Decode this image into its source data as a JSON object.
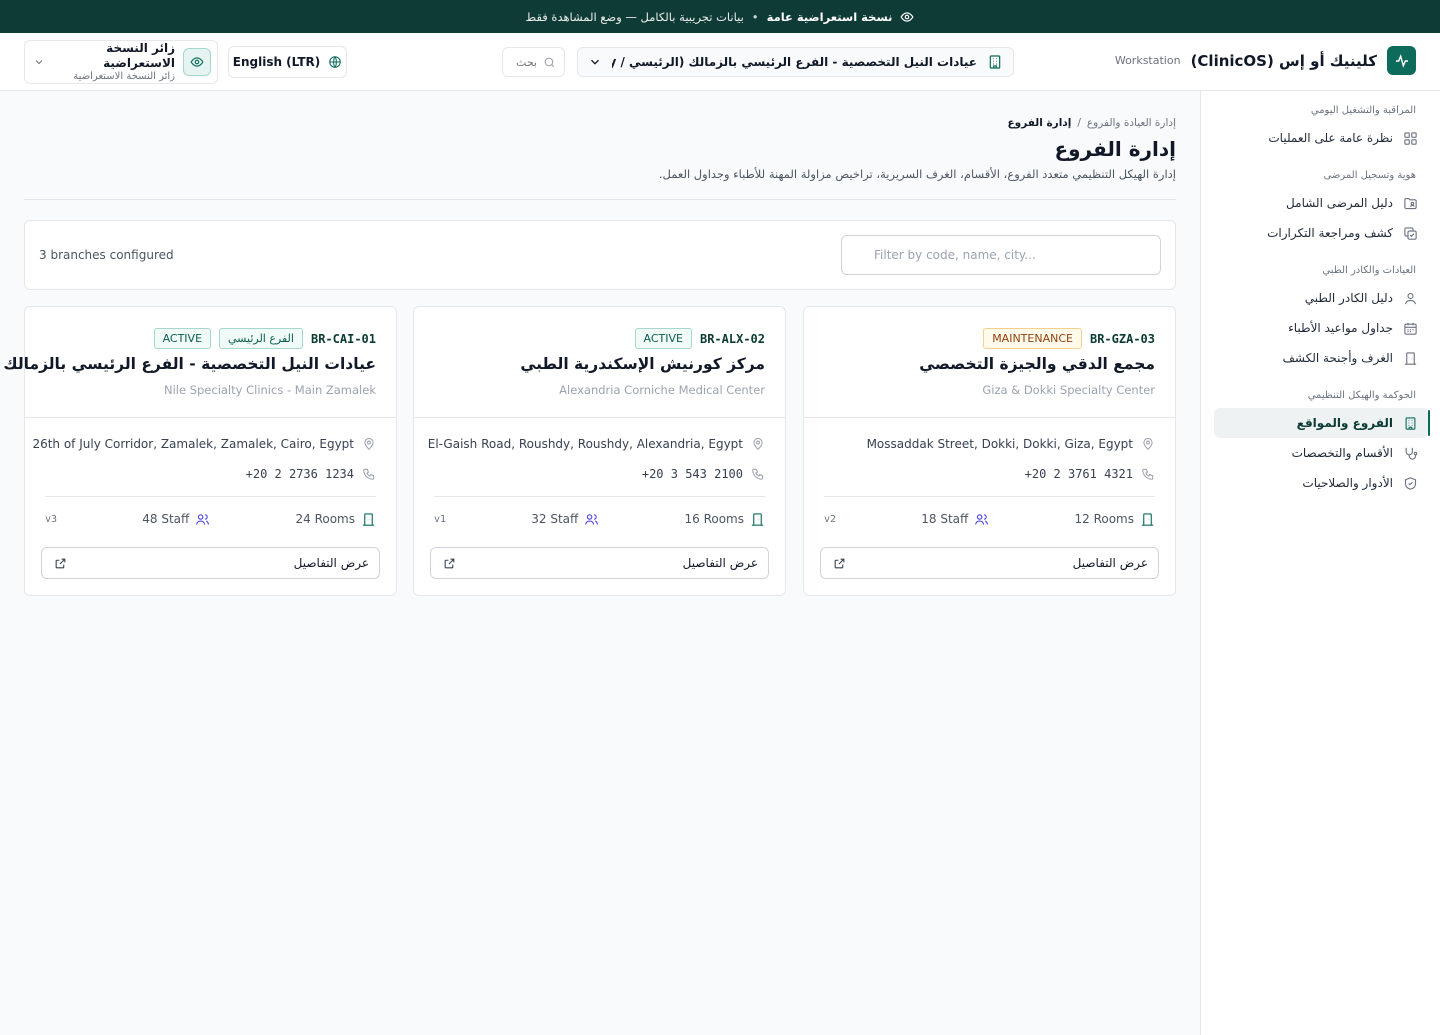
{
  "banner": {
    "title": "نسخة استعراضية عامة",
    "subtitle": "بيانات تجريبية بالكامل — وضع المشاهدة فقط"
  },
  "header": {
    "brand_name": "كلينيك أو إس (ClinicOS)",
    "brand_sub": "Workstation",
    "branch_selector": "عيادات النيل التخصصية - الفرع الرئيسي بالزمالك (الرئيسي / Primary)",
    "search_placeholder": "بحث",
    "language": "English (LTR)",
    "user_name": "زائر النسخة الاستعراضية",
    "user_role": "زائر النسخة الاستعراضية"
  },
  "sidebar": {
    "sections": [
      {
        "title": "المراقبة والتشغيل اليومي",
        "items": [
          {
            "label": "نظرة عامة على العمليات",
            "icon": "layout-grid-icon",
            "active": false
          }
        ]
      },
      {
        "title": "هوية وتسجيل المرضى",
        "items": [
          {
            "label": "دليل المرضى الشامل",
            "icon": "folder-user-icon",
            "active": false
          },
          {
            "label": "كشف ومراجعة التكرارات",
            "icon": "copy-check-icon",
            "active": false
          }
        ]
      },
      {
        "title": "العيادات والكادر الطبي",
        "items": [
          {
            "label": "دليل الكادر الطبي",
            "icon": "user-icon",
            "active": false
          },
          {
            "label": "جداول مواعيد الأطباء",
            "icon": "calendar-icon",
            "active": false
          },
          {
            "label": "الغرف وأجنحة الكشف",
            "icon": "door-icon",
            "active": false
          }
        ]
      },
      {
        "title": "الحوكمة والهيكل التنظيمي",
        "items": [
          {
            "label": "الفروع والمواقع",
            "icon": "building-icon",
            "active": true
          },
          {
            "label": "الأقسام والتخصصات",
            "icon": "stethoscope-icon",
            "active": false
          },
          {
            "label": "الأدوار والصلاحيات",
            "icon": "shield-icon",
            "active": false
          }
        ]
      }
    ]
  },
  "main": {
    "breadcrumb_parent": "إدارة العيادة والفروع",
    "breadcrumb_current": "إدارة الفروع",
    "title": "إدارة الفروع",
    "description": "إدارة الهيكل التنظيمي متعدد الفروع، الأقسام، الغرف السريرية، تراخيص مزاولة المهنة للأطباء وجداول العمل.",
    "filter_placeholder": "Filter by code, name, city...",
    "count_label": "3 branches configured"
  },
  "branches": [
    {
      "code": "BR-GZA-03",
      "status": "MAINTENANCE",
      "status_color": "#92400e",
      "primary_label": "",
      "name_ar": "مجمع الدقي والجيزة التخصصي",
      "name_en": "Giza & Dokki Specialty Center",
      "address": "Mossaddak Street, Dokki, Dokki, Giza, Egypt",
      "phone": "+20 2 3761 4321",
      "rooms": "12 Rooms",
      "staff": "18 Staff",
      "version": "v2",
      "details_label": "عرض التفاصيل"
    },
    {
      "code": "BR-ALX-02",
      "status": "ACTIVE",
      "status_color": "#0b5d50",
      "primary_label": "",
      "name_ar": "مركز كورنيش الإسكندرية الطبي",
      "name_en": "Alexandria Corniche Medical Center",
      "address": "El-Gaish Road, Roushdy, Roushdy, Alexandria, Egypt",
      "phone": "+20 3 543 2100",
      "rooms": "16 Rooms",
      "staff": "32 Staff",
      "version": "v1",
      "details_label": "عرض التفاصيل"
    },
    {
      "code": "BR-CAI-01",
      "status": "ACTIVE",
      "status_color": "#0b5d50",
      "primary_label": "الفرع الرئيسي",
      "name_ar": "عيادات النيل التخصصية - الفرع الرئيسي بالزمالك",
      "name_en": "Nile Specialty Clinics - Main Zamalek",
      "address": "26th of July Corridor, Zamalek, Zamalek, Cairo, Egypt",
      "phone": "+20 2 2736 1234",
      "rooms": "24 Rooms",
      "staff": "48 Staff",
      "version": "v3",
      "details_label": "عرض التفاصيل"
    }
  ],
  "colors": {
    "brand": "#0d6b5c",
    "banner": "#0f3b36",
    "accent_staff": "#4f46e5"
  }
}
